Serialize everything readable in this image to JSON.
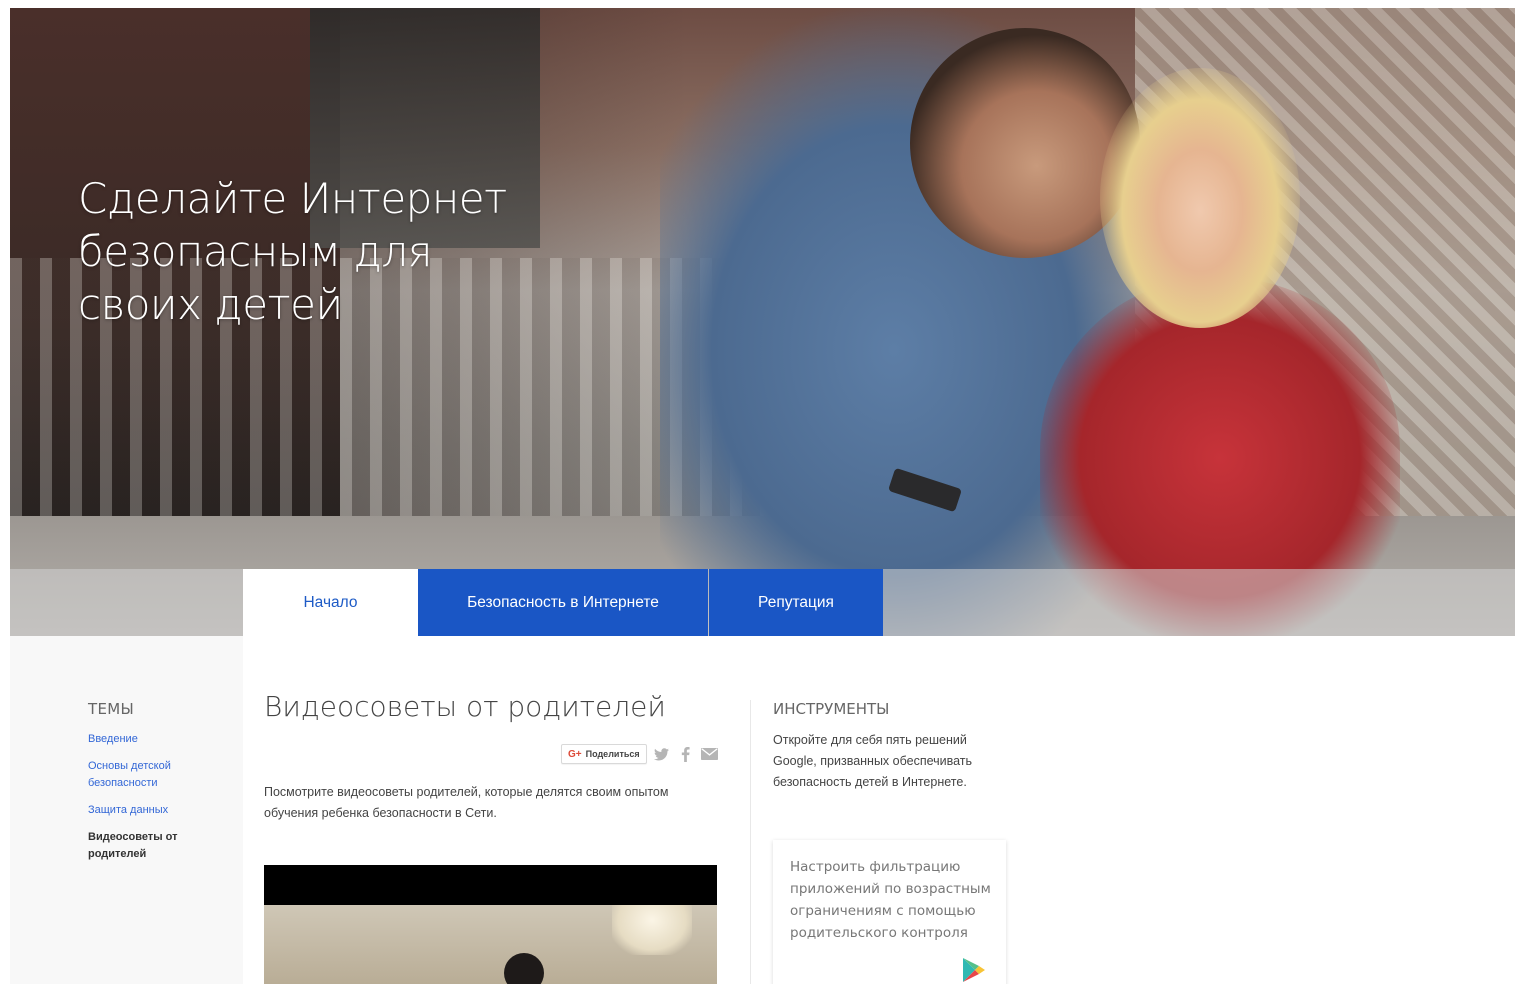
{
  "hero": {
    "title_line1": "Сделайте Интернет",
    "title_line2": "безопасным для",
    "title_line3": "своих детей"
  },
  "nav": {
    "tabs": [
      {
        "label": "Начало",
        "active": true
      },
      {
        "label": "Безопасность в Интернете",
        "active": false
      },
      {
        "label": "Репутация",
        "active": false
      }
    ]
  },
  "sidebar": {
    "heading": "ТЕМЫ",
    "items": [
      {
        "label": "Введение"
      },
      {
        "label": "Основы детской безопасности"
      },
      {
        "label": "Защита данных"
      },
      {
        "label": "Видеосоветы от родителей",
        "active": true
      }
    ]
  },
  "main": {
    "title": "Видеосоветы от родителей",
    "share": {
      "gplus_label": "Поделиться",
      "icons": [
        "twitter-icon",
        "facebook-icon",
        "email-icon"
      ]
    },
    "intro": "Посмотрите видеосоветы родителей, которые делятся своим опытом обучения ребенка безопасности в Сети."
  },
  "tools": {
    "heading": "ИНСТРУМЕНТЫ",
    "description": "Откройте для себя пять решений Google, призванных обеспечивать безопасность детей в Интернете.",
    "card": {
      "text": "Настроить фильтрацию приложений по возрастным ограничениям с помощью родительского контроля",
      "icon": "google-play-icon"
    }
  },
  "colors": {
    "accent": "#1a56c5",
    "link": "#3367d6",
    "text": "#444444"
  }
}
